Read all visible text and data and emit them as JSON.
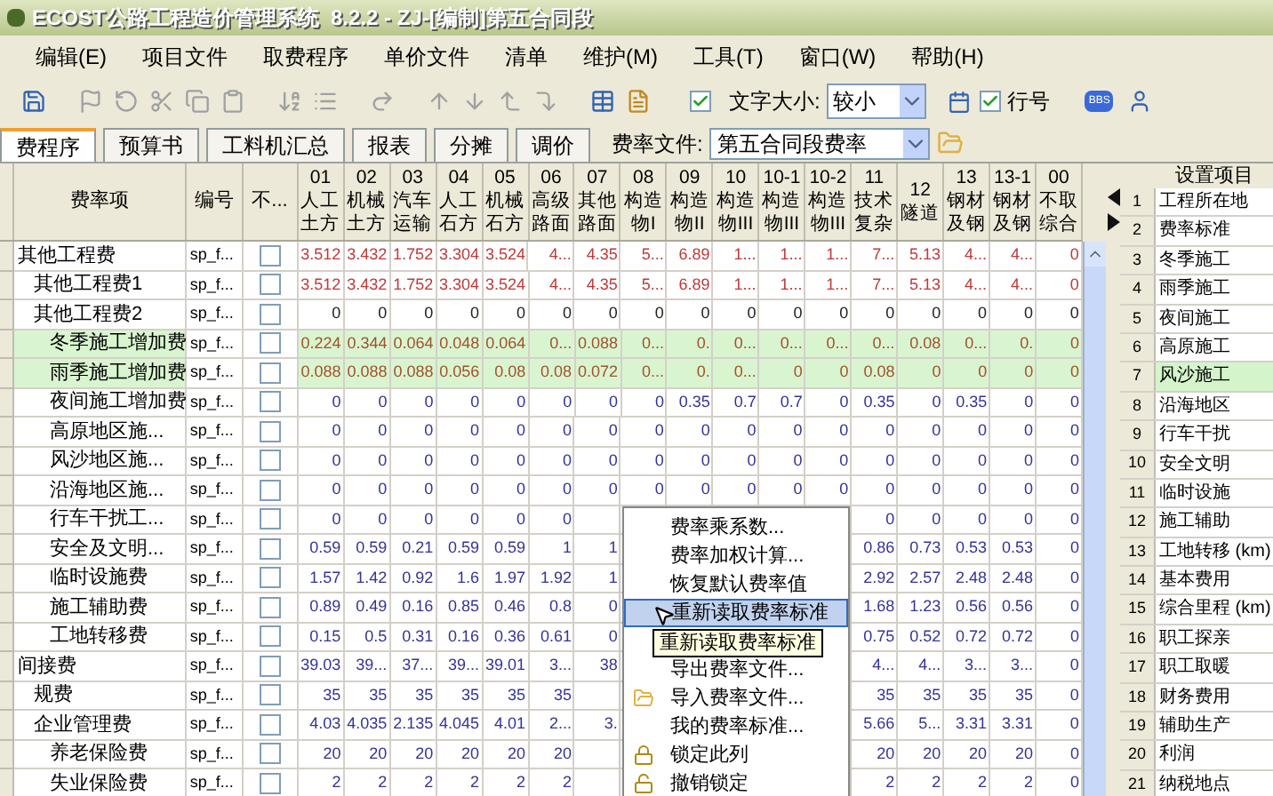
{
  "window": {
    "title": "ECOST公路工程造价管理系统  8.2.2 - ZJ-[编制]第五合同段"
  },
  "menu": [
    "编辑(E)",
    "项目文件",
    "取费程序",
    "单价文件",
    "清单",
    "维护(M)",
    "工具(T)",
    "窗口(W)",
    "帮助(H)"
  ],
  "toolbar": {
    "font_size": {
      "checked": true,
      "label": "文字大小:",
      "value": "较小"
    },
    "row_numbers": {
      "checked": true,
      "label": "行号"
    },
    "bbs": "BBS"
  },
  "tabs": [
    {
      "label": "费程序",
      "selected": true
    },
    {
      "label": "预算书",
      "selected": false
    },
    {
      "label": "工料机汇总",
      "selected": false
    },
    {
      "label": "报表",
      "selected": false
    },
    {
      "label": "分摊",
      "selected": false
    },
    {
      "label": "调价",
      "selected": false
    }
  ],
  "rate_file": {
    "label": "费率文件:",
    "value": "第五合同段费率"
  },
  "table": {
    "headers": {
      "name": "费率项",
      "code": "编号",
      "exclude": "不..."
    },
    "columns": [
      {
        "code": "01",
        "name": "人工土方"
      },
      {
        "code": "02",
        "name": "机械土方"
      },
      {
        "code": "03",
        "name": "汽车运输"
      },
      {
        "code": "04",
        "name": "人工石方"
      },
      {
        "code": "05",
        "name": "机械石方"
      },
      {
        "code": "06",
        "name": "高级路面"
      },
      {
        "code": "07",
        "name": "其他路面"
      },
      {
        "code": "08",
        "name": "构造物I"
      },
      {
        "code": "09",
        "name": "构造物II"
      },
      {
        "code": "10",
        "name": "构造物III"
      },
      {
        "code": "10-1",
        "name": "构造物III"
      },
      {
        "code": "10-2",
        "name": "构造物III"
      },
      {
        "code": "11",
        "name": "技术复杂"
      },
      {
        "code": "12",
        "name": "隧道"
      },
      {
        "code": "13",
        "name": "钢材及钢"
      },
      {
        "code": "13-1",
        "name": "钢材及钢"
      },
      {
        "code": "00",
        "name": "不取综合"
      }
    ],
    "rows": [
      {
        "name": "其他工程费",
        "code": "sp_f...",
        "checked": false,
        "kind": "summary",
        "values": {
          "c0": "3.512",
          "c1": "3.432",
          "c2": "1.752",
          "c3": "3.304",
          "c4": "3.524",
          "c5": "4...",
          "c6": "4.35",
          "c7": "5...",
          "c8": "6.89",
          "c9": "1...",
          "c10": "1...",
          "c11": "1...",
          "c12": "7...",
          "c13": "5.13",
          "c14": "4...",
          "c15": "4...",
          "c16": "0"
        },
        "children": [
          {
            "name": "其他工程费1",
            "code": "sp_f...",
            "checked": false,
            "kind": "summary",
            "values": {
              "c0": "3.512",
              "c1": "3.432",
              "c2": "1.752",
              "c3": "3.304",
              "c4": "3.524",
              "c5": "4...",
              "c6": "4.35",
              "c7": "5...",
              "c8": "6.89",
              "c9": "1...",
              "c10": "1...",
              "c11": "1...",
              "c12": "7...",
              "c13": "5.13",
              "c14": "4...",
              "c15": "4...",
              "c16": "0"
            }
          },
          {
            "name": "其他工程费2",
            "code": "sp_f...",
            "checked": false,
            "kind": "group",
            "values": {
              "c0": "0",
              "c1": "0",
              "c2": "0",
              "c3": "0",
              "c4": "0",
              "c5": "0",
              "c6": "0",
              "c7": "0",
              "c8": "0",
              "c9": "0",
              "c10": "0",
              "c11": "0",
              "c12": "0",
              "c13": "0",
              "c14": "0",
              "c15": "0",
              "c16": "0"
            },
            "children": [
              {
                "name": "冬季施工增加费",
                "code": "sp_f...",
                "checked": false,
                "kind": "highlighted",
                "values": {
                  "c0": "0.224",
                  "c1": "0.344",
                  "c2": "0.064",
                  "c3": "0.048",
                  "c4": "0.064",
                  "c5": "0...",
                  "c6": "0.088",
                  "c7": "0...",
                  "c8": "0.",
                  "c9": "0...",
                  "c10": "0...",
                  "c11": "0...",
                  "c12": "0...",
                  "c13": "0.08",
                  "c14": "0...",
                  "c15": "0.",
                  "c16": "0"
                }
              },
              {
                "name": "雨季施工增加费",
                "code": "sp_f...",
                "checked": false,
                "kind": "highlighted",
                "values": {
                  "c0": "0.088",
                  "c1": "0.088",
                  "c2": "0.088",
                  "c3": "0.056",
                  "c4": "0.08",
                  "c5": "0.08",
                  "c6": "0.072",
                  "c7": "0...",
                  "c8": "0.",
                  "c9": "0...",
                  "c10": "0",
                  "c11": "0",
                  "c12": "0.08",
                  "c13": "0",
                  "c14": "0",
                  "c15": "0",
                  "c16": "0"
                }
              },
              {
                "name": "夜间施工增加费",
                "code": "sp_f...",
                "checked": false,
                "kind": "normal",
                "values": {
                  "c0": "0",
                  "c1": "0",
                  "c2": "0",
                  "c3": "0",
                  "c4": "0",
                  "c5": "0",
                  "c6": "0",
                  "c7": "0",
                  "c8": "0.35",
                  "c9": "0.7",
                  "c10": "0.7",
                  "c11": "0",
                  "c12": "0.35",
                  "c13": "0",
                  "c14": "0.35",
                  "c15": "0",
                  "c16": "0"
                }
              },
              {
                "name": "高原地区施...",
                "code": "sp_f...",
                "checked": false,
                "kind": "normal",
                "values": {
                  "c0": "0",
                  "c1": "0",
                  "c2": "0",
                  "c3": "0",
                  "c4": "0",
                  "c5": "0",
                  "c6": "0",
                  "c7": "0",
                  "c8": "0",
                  "c9": "0",
                  "c10": "0",
                  "c11": "0",
                  "c12": "0",
                  "c13": "0",
                  "c14": "0",
                  "c15": "0",
                  "c16": "0"
                }
              },
              {
                "name": "风沙地区施...",
                "code": "sp_f...",
                "checked": false,
                "kind": "normal",
                "values": {
                  "c0": "0",
                  "c1": "0",
                  "c2": "0",
                  "c3": "0",
                  "c4": "0",
                  "c5": "0",
                  "c6": "0",
                  "c7": "0",
                  "c8": "0",
                  "c9": "0",
                  "c10": "0",
                  "c11": "0",
                  "c12": "0",
                  "c13": "0",
                  "c14": "0",
                  "c15": "0",
                  "c16": "0"
                }
              },
              {
                "name": "沿海地区施...",
                "code": "sp_f...",
                "checked": false,
                "kind": "normal",
                "values": {
                  "c0": "0",
                  "c1": "0",
                  "c2": "0",
                  "c3": "0",
                  "c4": "0",
                  "c5": "0",
                  "c6": "0",
                  "c7": "0",
                  "c8": "0",
                  "c9": "0",
                  "c10": "0",
                  "c11": "0",
                  "c12": "0",
                  "c13": "0",
                  "c14": "0",
                  "c15": "0",
                  "c16": "0"
                }
              },
              {
                "name": "行车干扰工...",
                "code": "sp_f...",
                "checked": false,
                "kind": "normal",
                "values": {
                  "c0": "0",
                  "c1": "0",
                  "c2": "0",
                  "c3": "0",
                  "c4": "0",
                  "c5": "0",
                  "c12": "0",
                  "c13": "0",
                  "c14": "0",
                  "c15": "0",
                  "c16": "0"
                }
              },
              {
                "name": "安全及文明...",
                "code": "sp_f...",
                "checked": false,
                "kind": "normal",
                "values": {
                  "c0": "0.59",
                  "c1": "0.59",
                  "c2": "0.21",
                  "c3": "0.59",
                  "c4": "0.59",
                  "c5": "1",
                  "c6": "1",
                  "c12": "0.86",
                  "c13": "0.73",
                  "c14": "0.53",
                  "c15": "0.53",
                  "c16": "0"
                }
              },
              {
                "name": "临时设施费",
                "code": "sp_f...",
                "checked": false,
                "kind": "normal",
                "values": {
                  "c0": "1.57",
                  "c1": "1.42",
                  "c2": "0.92",
                  "c3": "1.6",
                  "c4": "1.97",
                  "c5": "1.92",
                  "c6": "1",
                  "c12": "2.92",
                  "c13": "2.57",
                  "c14": "2.48",
                  "c15": "2.48",
                  "c16": "0"
                }
              },
              {
                "name": "施工辅助费",
                "code": "sp_f...",
                "checked": false,
                "kind": "normal",
                "values": {
                  "c0": "0.89",
                  "c1": "0.49",
                  "c2": "0.16",
                  "c3": "0.85",
                  "c4": "0.46",
                  "c5": "0.8",
                  "c6": "0",
                  "c12": "1.68",
                  "c13": "1.23",
                  "c14": "0.56",
                  "c15": "0.56",
                  "c16": "0"
                }
              },
              {
                "name": "工地转移费",
                "code": "sp_f...",
                "checked": false,
                "kind": "normal",
                "values": {
                  "c0": "0.15",
                  "c1": "0.5",
                  "c2": "0.31",
                  "c3": "0.16",
                  "c4": "0.36",
                  "c5": "0.61",
                  "c6": "0",
                  "c12": "0.75",
                  "c13": "0.52",
                  "c14": "0.72",
                  "c15": "0.72",
                  "c16": "0"
                }
              }
            ]
          }
        ]
      },
      {
        "name": "间接费",
        "code": "sp_f...",
        "checked": false,
        "kind": "normal",
        "values": {
          "c0": "39.03",
          "c1": "39...",
          "c2": "37...",
          "c3": "39...",
          "c4": "39.01",
          "c5": "3...",
          "c6": "38",
          "c12": "4...",
          "c13": "4...",
          "c14": "3...",
          "c15": "3...",
          "c16": "0"
        },
        "children": [
          {
            "name": "规费",
            "code": "sp_f...",
            "checked": false,
            "kind": "normal",
            "values": {
              "c0": "35",
              "c1": "35",
              "c2": "35",
              "c3": "35",
              "c4": "35",
              "c5": "35",
              "c12": "35",
              "c13": "35",
              "c14": "35",
              "c15": "35",
              "c16": "0"
            }
          },
          {
            "name": "企业管理费",
            "code": "sp_f...",
            "checked": false,
            "kind": "normal",
            "values": {
              "c0": "4.03",
              "c1": "4.035",
              "c2": "2.135",
              "c3": "4.045",
              "c4": "4.01",
              "c5": "2...",
              "c6": "3.",
              "c12": "5.66",
              "c13": "5...",
              "c14": "3.31",
              "c15": "3.31",
              "c16": "0"
            },
            "children": [
              {
                "name": "养老保险费",
                "code": "sp_f...",
                "checked": false,
                "kind": "normal",
                "values": {
                  "c0": "20",
                  "c1": "20",
                  "c2": "20",
                  "c3": "20",
                  "c4": "20",
                  "c5": "20",
                  "c12": "20",
                  "c13": "20",
                  "c14": "20",
                  "c15": "20",
                  "c16": "0"
                }
              },
              {
                "name": "失业保险费",
                "code": "sp_f...",
                "checked": false,
                "kind": "normal",
                "values": {
                  "c0": "2",
                  "c1": "2",
                  "c2": "2",
                  "c3": "2",
                  "c4": "2",
                  "c5": "2",
                  "c12": "2",
                  "c13": "2",
                  "c14": "2",
                  "c15": "2",
                  "c16": "0"
                }
              }
            ]
          }
        ]
      }
    ]
  },
  "settings": {
    "header": "设置项目",
    "items": [
      {
        "number": "1",
        "label": "工程所在地",
        "selected": false
      },
      {
        "number": "2",
        "label": "费率标准",
        "selected": false
      },
      {
        "number": "3",
        "label": "冬季施工",
        "selected": false
      },
      {
        "number": "4",
        "label": "雨季施工",
        "selected": false
      },
      {
        "number": "5",
        "label": "夜间施工",
        "selected": false
      },
      {
        "number": "6",
        "label": "高原施工",
        "selected": false
      },
      {
        "number": "7",
        "label": "风沙施工",
        "selected": true
      },
      {
        "number": "8",
        "label": "沿海地区",
        "selected": false
      },
      {
        "number": "9",
        "label": "行车干扰",
        "selected": false
      },
      {
        "number": "10",
        "label": "安全文明",
        "selected": false
      },
      {
        "number": "11",
        "label": "临时设施",
        "selected": false
      },
      {
        "number": "12",
        "label": "施工辅助",
        "selected": false
      },
      {
        "number": "13",
        "label": "工地转移 (km)",
        "selected": false
      },
      {
        "number": "14",
        "label": "基本费用",
        "selected": false
      },
      {
        "number": "15",
        "label": "综合里程 (km)",
        "selected": false
      },
      {
        "number": "16",
        "label": "职工探亲",
        "selected": false
      },
      {
        "number": "17",
        "label": "职工取暖",
        "selected": false
      },
      {
        "number": "18",
        "label": "财务费用",
        "selected": false
      },
      {
        "number": "19",
        "label": "辅助生产",
        "selected": false
      },
      {
        "number": "20",
        "label": "利润",
        "selected": false
      },
      {
        "number": "21",
        "label": "纳税地点",
        "selected": false
      }
    ]
  },
  "context_menu": {
    "items": [
      {
        "kind": "item",
        "label": "费率乘系数...",
        "selected": false
      },
      {
        "kind": "item",
        "label": "费率加权计算...",
        "selected": false
      },
      {
        "kind": "item",
        "label": "恢复默认费率值",
        "selected": false
      },
      {
        "kind": "item",
        "label": "重新读取费率标准",
        "selected": true
      },
      {
        "kind": "covered"
      },
      {
        "kind": "item",
        "label": "导出费率文件...",
        "selected": false
      },
      {
        "kind": "folder",
        "label": "导入费率文件...",
        "selected": false
      },
      {
        "kind": "item",
        "label": "我的费率标准...",
        "selected": false
      },
      {
        "kind": "lock",
        "label": "锁定此列",
        "selected": false
      },
      {
        "kind": "unlock",
        "label": "撤销锁定",
        "selected": false
      }
    ],
    "tooltip": "重新读取费率标准"
  }
}
